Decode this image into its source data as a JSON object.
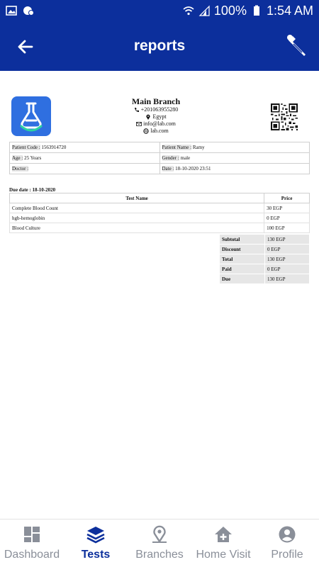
{
  "status_bar": {
    "battery": "100%",
    "time": "1:54 AM"
  },
  "app_bar": {
    "title": "reports"
  },
  "report": {
    "branch": {
      "name": "Main Branch",
      "phone": "+201063955280",
      "location": "Egypt",
      "email": "info@lab.com",
      "website": "lab.com"
    },
    "patient": {
      "code_label": "Patient Code :",
      "code": "1563914720",
      "name_label": "Patient Name :",
      "name": "Ramy",
      "age_label": "Age :",
      "age": "25 Years",
      "gender_label": "Gender :",
      "gender": "male",
      "doctor_label": "Doctor :",
      "doctor": "",
      "date_label": "Date :",
      "date": "18-10-2020 23:51"
    },
    "due_date": "Due date : 18-10-2020",
    "tests_header": {
      "name": "Test Name",
      "price": "Price"
    },
    "tests": [
      {
        "name": "Complete Blood Count",
        "price": "30 EGP"
      },
      {
        "name": "hgb-hemoglobin",
        "price": "0 EGP"
      },
      {
        "name": "Blood Culture",
        "price": "100 EGP"
      }
    ],
    "totals": [
      {
        "label": "Subtotal",
        "value": "130 EGP"
      },
      {
        "label": "Discount",
        "value": "0 EGP"
      },
      {
        "label": "Total",
        "value": "130 EGP"
      },
      {
        "label": "Paid",
        "value": "0 EGP"
      },
      {
        "label": "Due",
        "value": "130 EGP"
      }
    ]
  },
  "bottom_nav": [
    {
      "label": "Dashboard",
      "icon": "dashboard-icon"
    },
    {
      "label": "Tests",
      "icon": "layers-icon"
    },
    {
      "label": "Branches",
      "icon": "location-pin-icon"
    },
    {
      "label": "Home Visit",
      "icon": "home-plus-icon"
    },
    {
      "label": "Profile",
      "icon": "user-circle-icon"
    }
  ],
  "colors": {
    "brand": "#0c2f9c",
    "logo": "#2f6fe0",
    "inactive": "#8a8f99"
  }
}
